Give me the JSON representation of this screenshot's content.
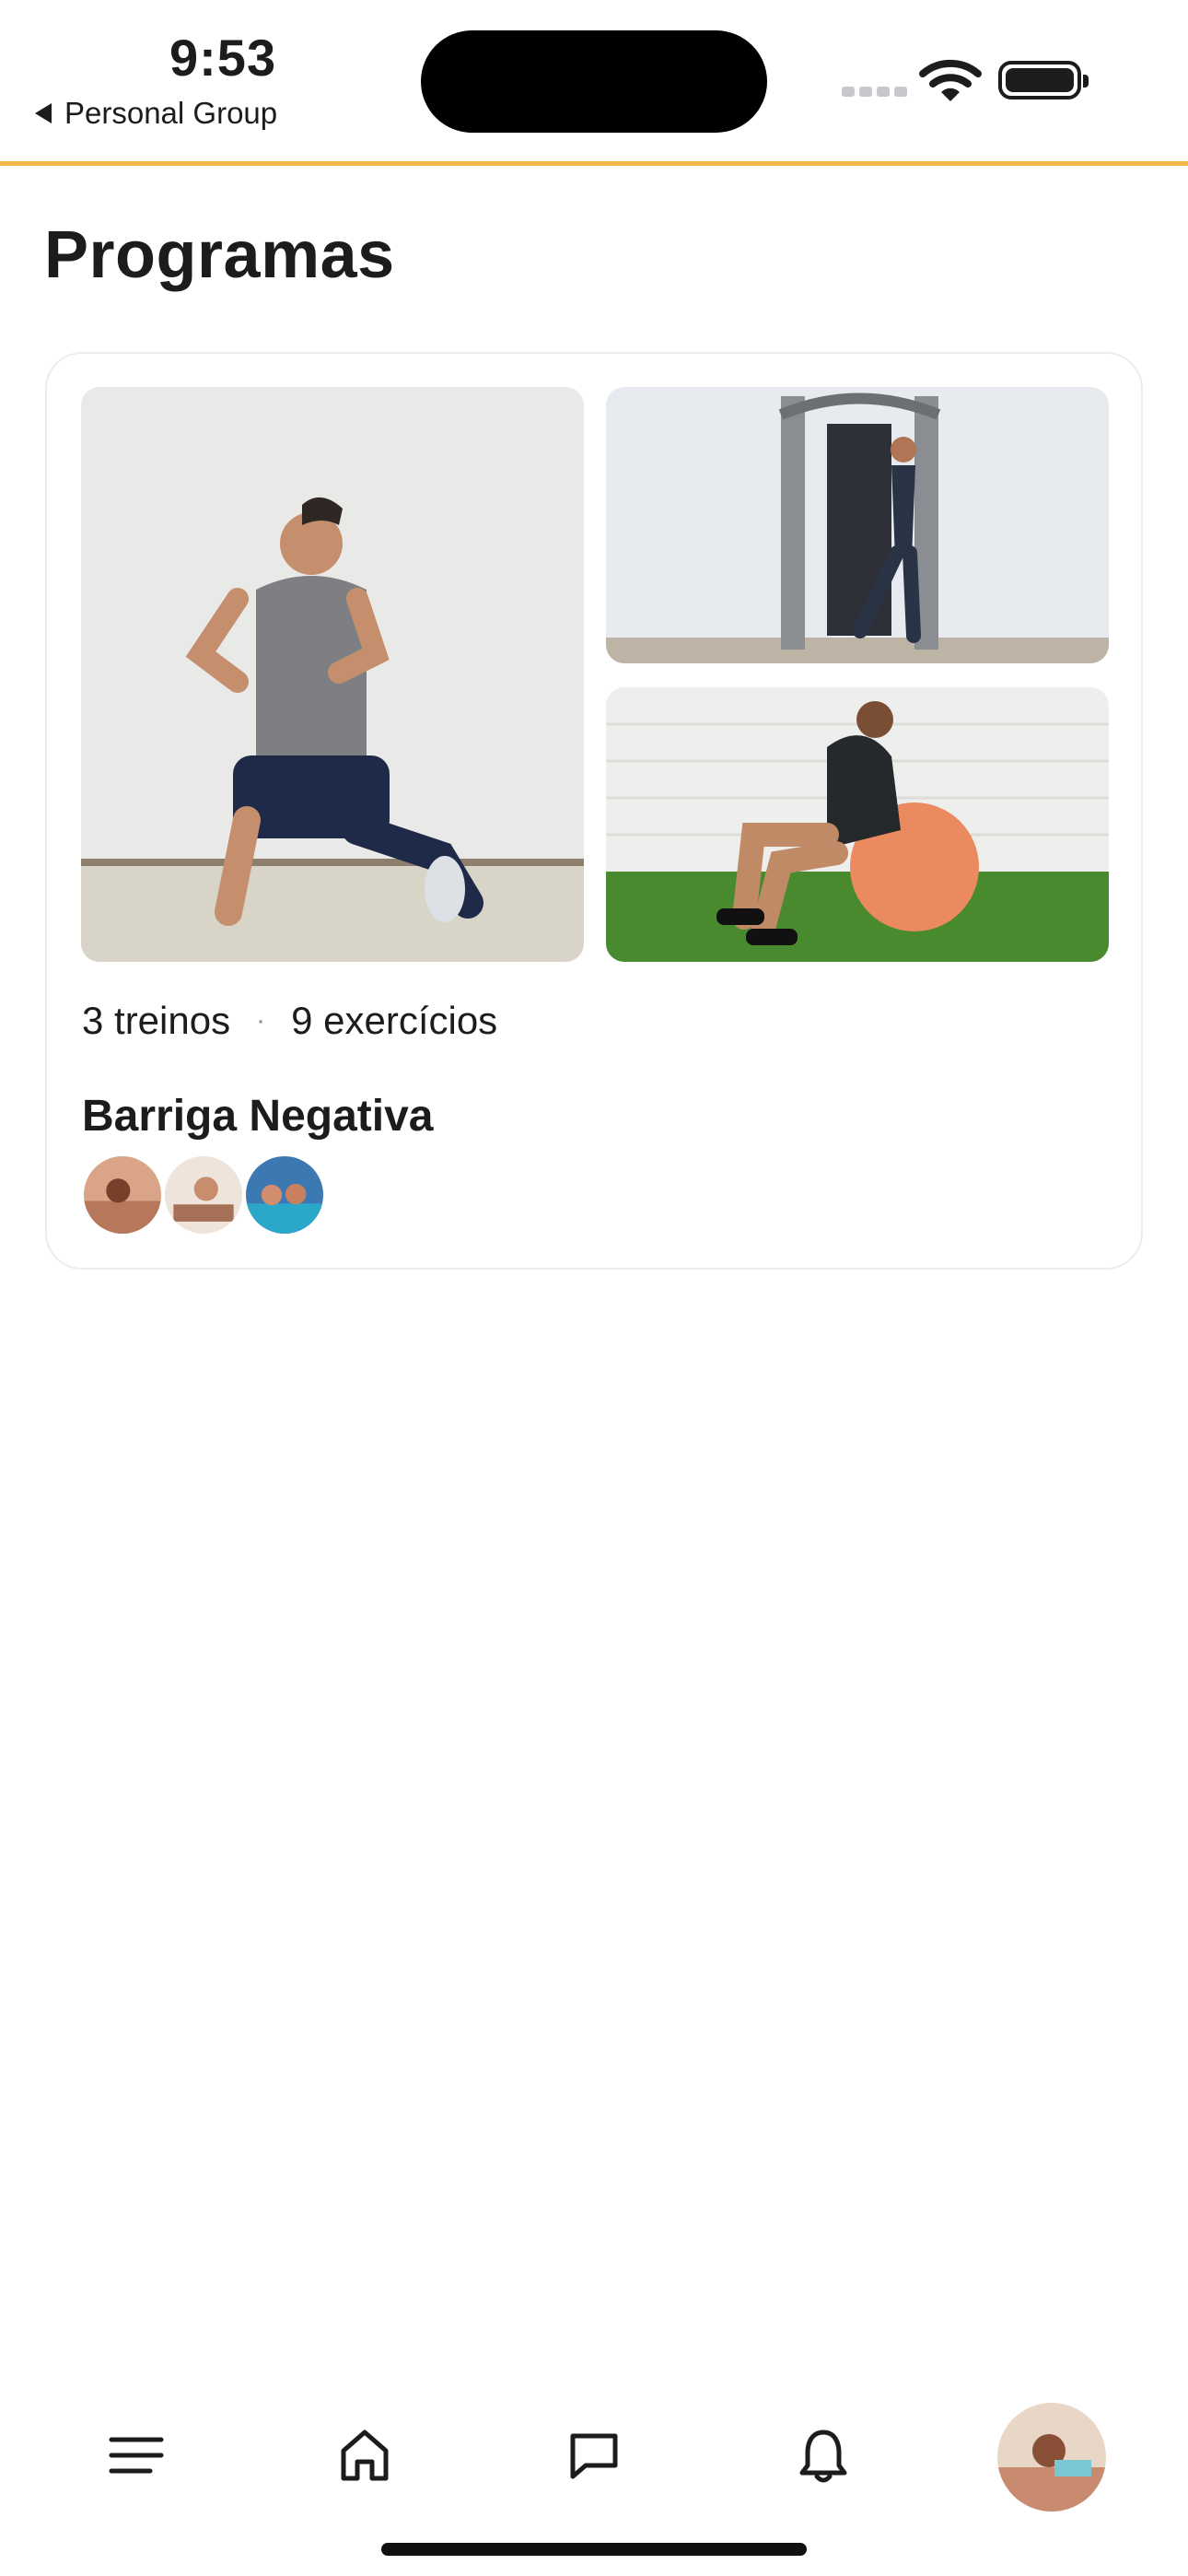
{
  "status_bar": {
    "time": "9:53",
    "back_app_label": "Personal Group",
    "icons": [
      "signal-icon",
      "wifi-icon",
      "battery-icon"
    ]
  },
  "theme": {
    "accent": "#f5b64a",
    "text": "#1c1c1e",
    "muted": "#8e8e93",
    "card_border": "#ececec"
  },
  "page": {
    "title": "Programas"
  },
  "program_card": {
    "images": [
      "lunge-exercise-photo",
      "cable-machine-exercise-photo",
      "stability-ball-exercise-photo"
    ],
    "workouts_count": "3 treinos",
    "separator": "·",
    "exercises_count": "9 exercícios",
    "name": "Barriga Negativa",
    "member_avatars": [
      "member-avatar-1",
      "member-avatar-2",
      "member-avatar-3"
    ]
  },
  "bottom_nav": {
    "items": [
      "menu-icon",
      "home-icon",
      "chat-icon",
      "bell-icon",
      "profile-avatar"
    ]
  }
}
